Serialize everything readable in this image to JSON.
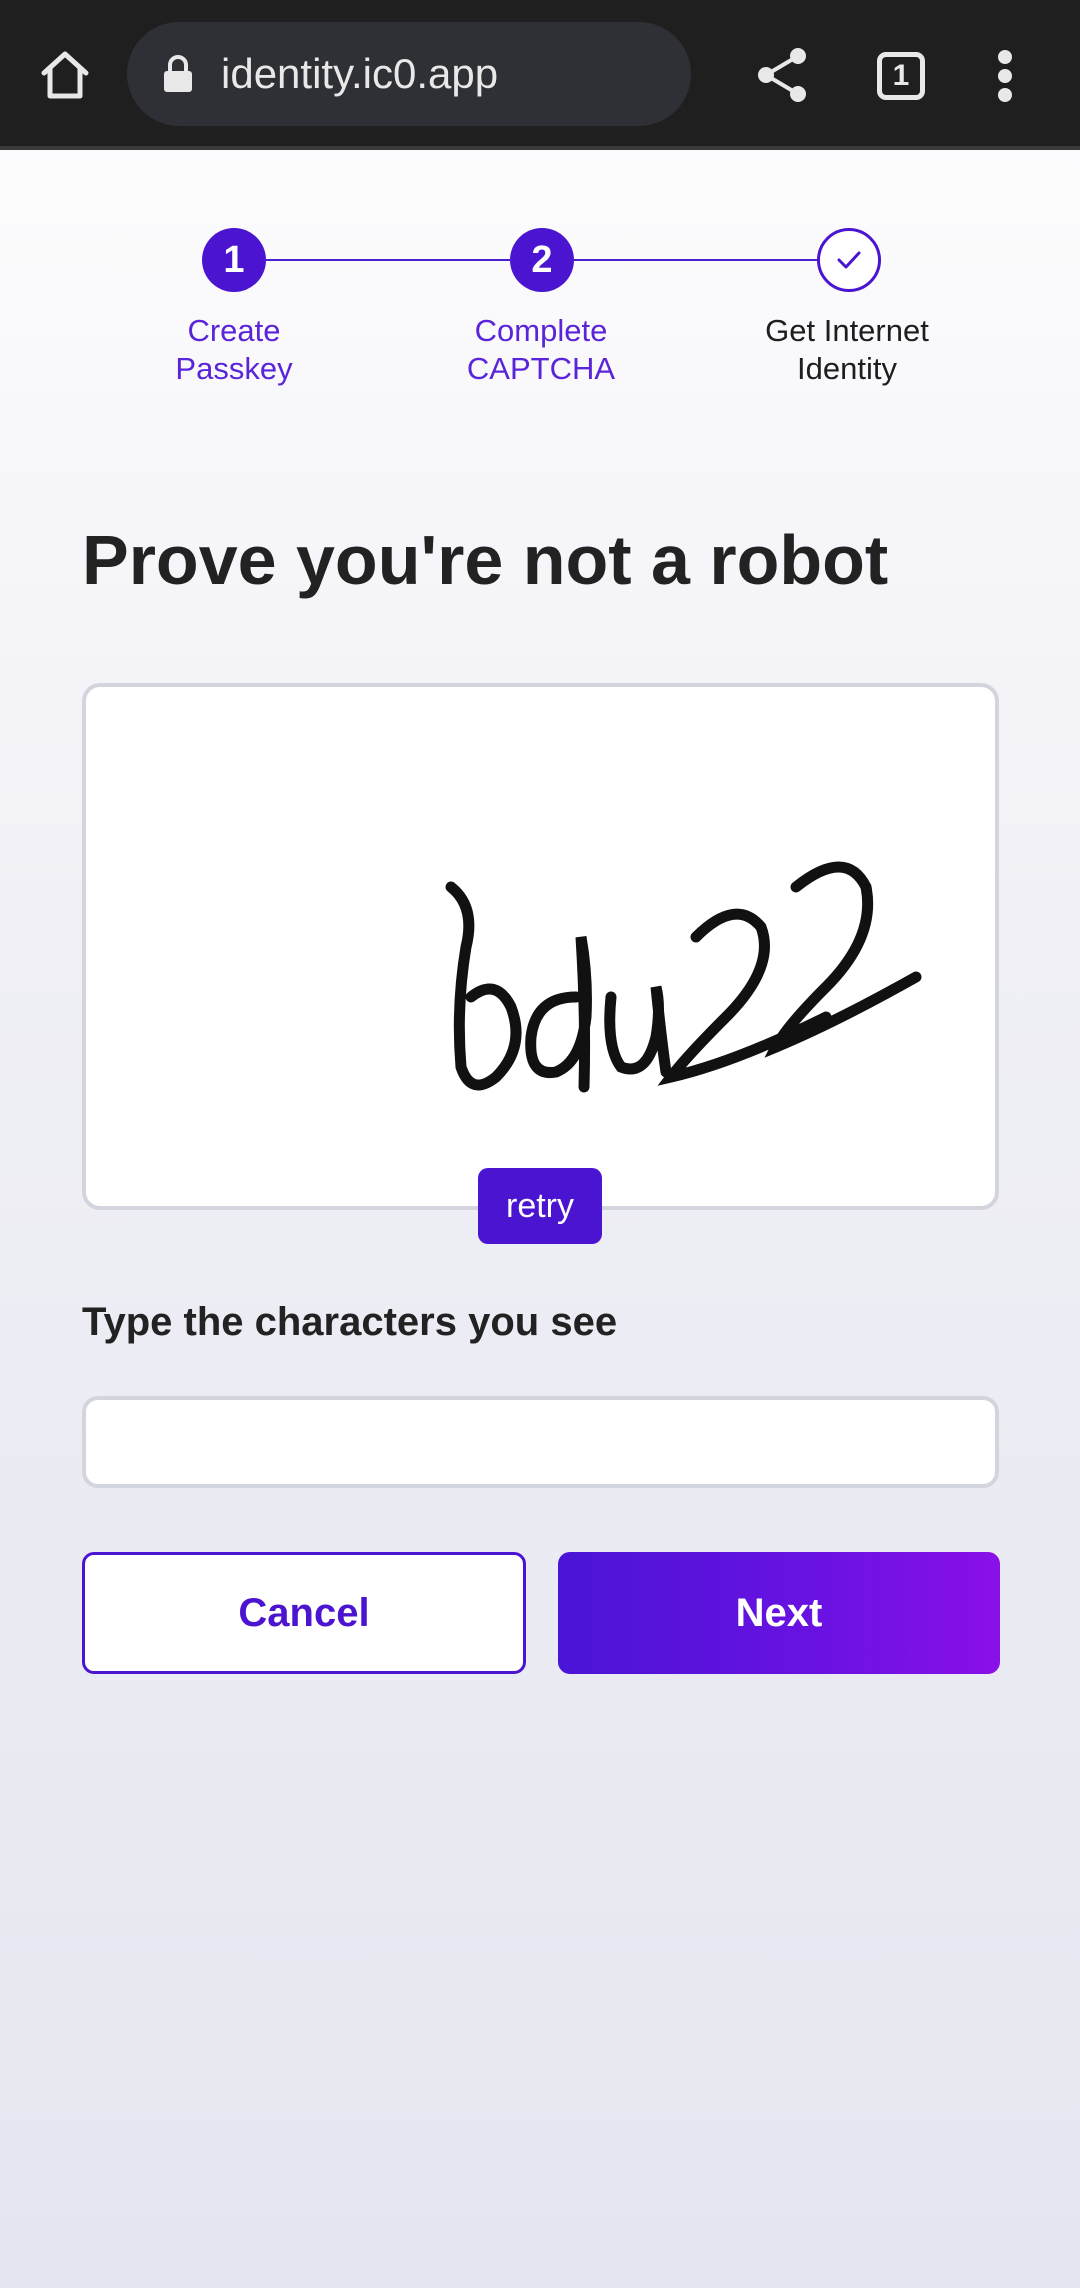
{
  "browser": {
    "url": "identity.ic0.app",
    "tab_count": "1"
  },
  "stepper": {
    "steps": [
      {
        "number": "1",
        "label_line1": "Create",
        "label_line2": "Passkey",
        "state": "done"
      },
      {
        "number": "2",
        "label_line1": "Complete",
        "label_line2": "CAPTCHA",
        "state": "current"
      },
      {
        "number": "",
        "label_line1": "Get Internet",
        "label_line2": "Identity",
        "state": "pending"
      }
    ]
  },
  "main": {
    "title": "Prove you're not a robot",
    "captcha_text": "bdu22",
    "retry_label": "retry",
    "field_label": "Type the characters you see",
    "input_value": "",
    "cancel_label": "Cancel",
    "next_label": "Next"
  },
  "colors": {
    "accent": "#4a14d0",
    "accent_gradient_end": "#8a10e8",
    "topbar": "#1f1f1f"
  }
}
